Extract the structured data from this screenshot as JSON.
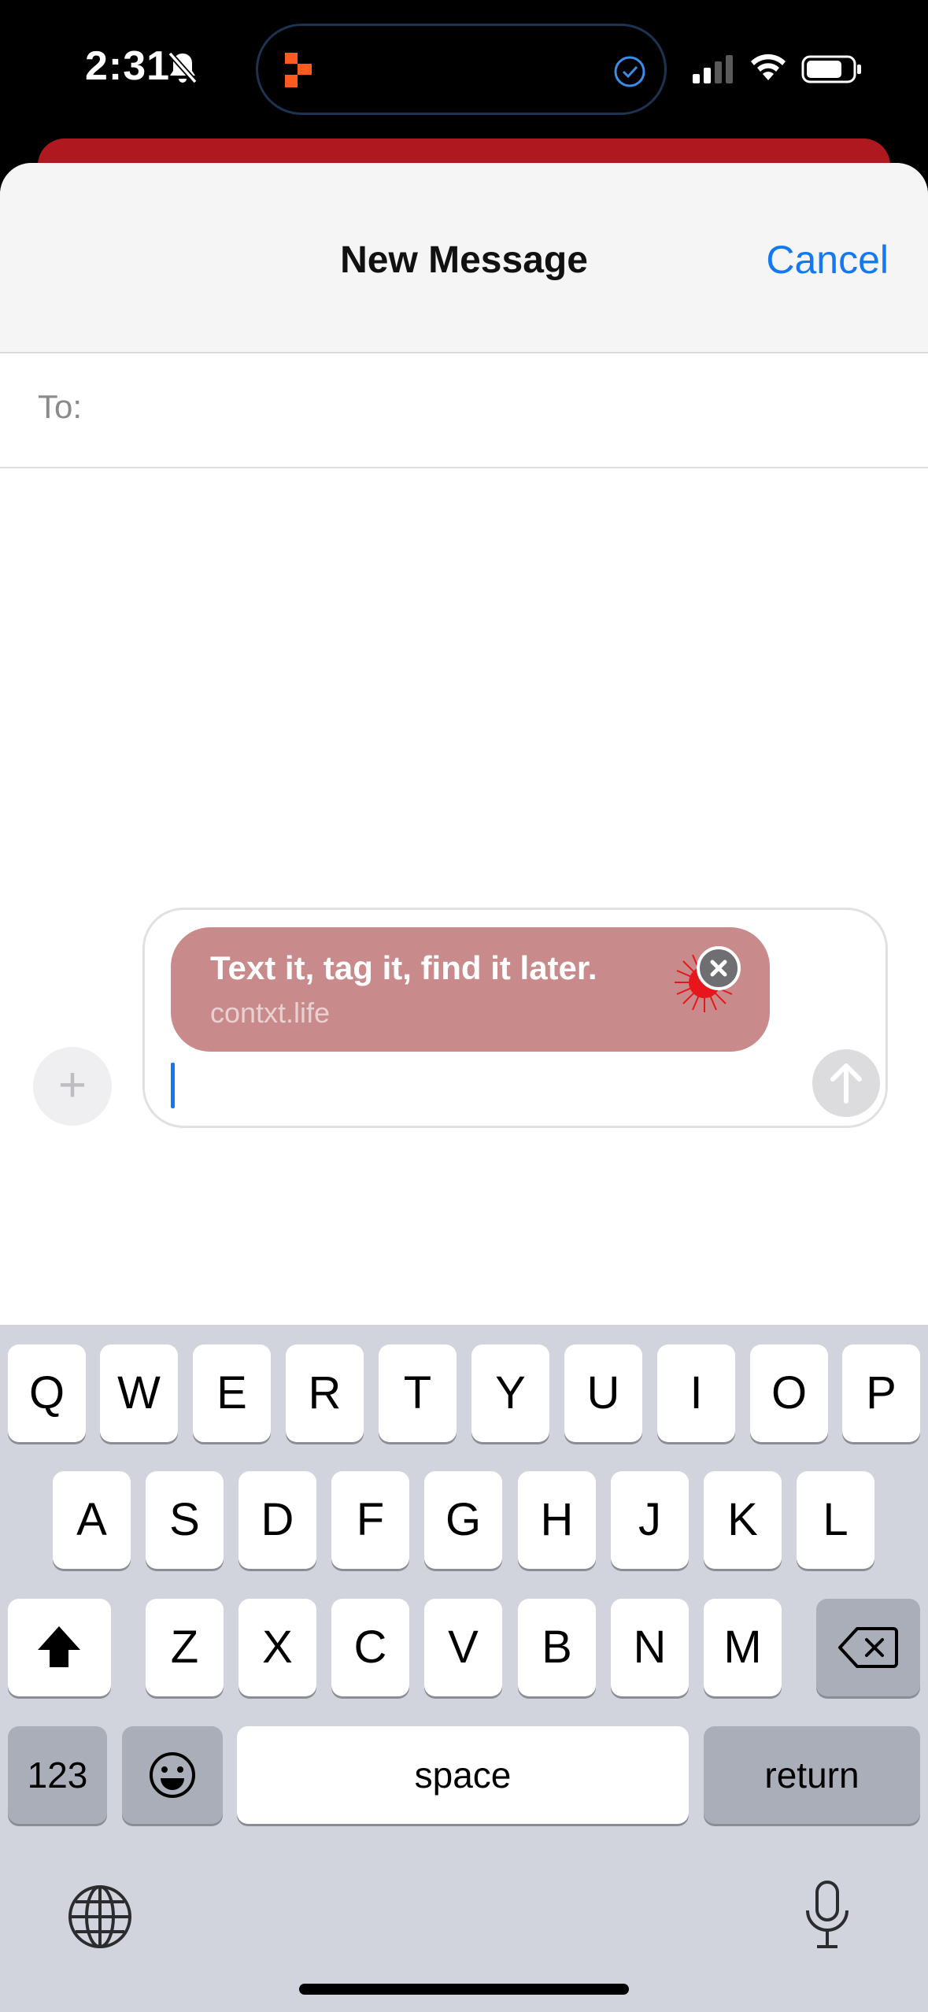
{
  "status_bar": {
    "time": "2:31",
    "icons": [
      "bell-slash-icon",
      "app-activity-icon",
      "check-circle-icon",
      "cellular-signal-icon",
      "wifi-icon",
      "battery-icon"
    ]
  },
  "nav": {
    "title": "New Message",
    "cancel_label": "Cancel"
  },
  "recipient": {
    "label": "To:"
  },
  "composer": {
    "preview_title": "Text it, tag it, find it later.",
    "preview_url": "contxt.life",
    "add_icon": "plus-icon",
    "send_icon": "arrow-up-icon",
    "remove_icon": "close-icon"
  },
  "keyboard": {
    "row1": [
      "Q",
      "W",
      "E",
      "R",
      "T",
      "Y",
      "U",
      "I",
      "O",
      "P"
    ],
    "row2": [
      "A",
      "S",
      "D",
      "F",
      "G",
      "H",
      "J",
      "K",
      "L"
    ],
    "row3": [
      "Z",
      "X",
      "C",
      "V",
      "B",
      "N",
      "M"
    ],
    "numbers_label": "123",
    "space_label": "space",
    "return_label": "return",
    "icons": [
      "shift-icon",
      "delete-icon",
      "emoji-icon",
      "globe-icon",
      "microphone-icon"
    ]
  },
  "colors": {
    "accent": "#1479f0",
    "preview_bg": "#c88a8a",
    "behind_card": "#b01820"
  }
}
